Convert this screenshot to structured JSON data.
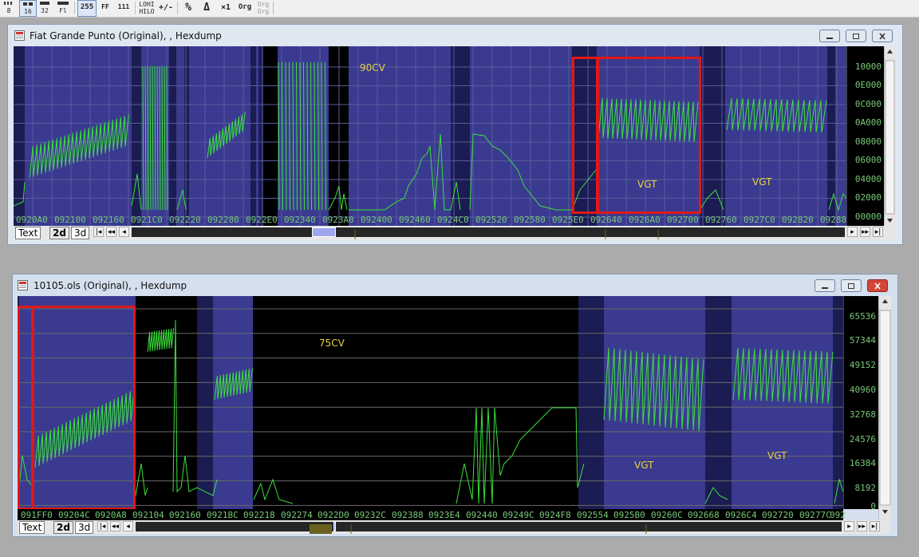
{
  "toolbar": {
    "items": [
      "8",
      "16",
      "32",
      "Fl",
      "255",
      "FF",
      "111",
      "LOHI HILO",
      "+/-",
      "%",
      "Δ",
      "×1",
      "Org",
      "Org Org"
    ]
  },
  "window1": {
    "title": "Fiat Grande Punto (Original), , Hexdump",
    "y_ticks": [
      "10000",
      "0E000",
      "0C000",
      "0A000",
      "08000",
      "06000",
      "04000",
      "02000",
      "00000"
    ],
    "x_ticks": [
      "0920A0",
      "092100",
      "092160",
      "0921C0",
      "092220",
      "092280",
      "0922E0",
      "092340",
      "0923A0",
      "092400",
      "092460",
      "0924C0",
      "092520",
      "092580",
      "0925E0",
      "092640",
      "0926A0",
      "092700",
      "092760",
      "0927C0",
      "092820",
      "09288"
    ],
    "annotations": [
      "90CV",
      "VGT",
      "VGT"
    ],
    "tabs": [
      "Text",
      "2d",
      "3d"
    ]
  },
  "window2": {
    "title": "10105.ols (Original), , Hexdump",
    "y_ticks": [
      "65536",
      "57344",
      "49152",
      "40960",
      "32768",
      "24576",
      "16384",
      "8192",
      "0"
    ],
    "x_ticks": [
      "091FF0",
      "09204C",
      "0920A8",
      "092104",
      "092160",
      "0921BC",
      "092218",
      "092274",
      "0922D0",
      "09232C",
      "092388",
      "0923E4",
      "092440",
      "09249C",
      "0924F8",
      "092554",
      "0925B0",
      "09260C",
      "092668",
      "0926C4",
      "092720",
      "09277C",
      "092"
    ],
    "annotations": [
      "75CV",
      "VGT",
      "VGT"
    ],
    "tabs": [
      "Text",
      "2d",
      "3d"
    ]
  },
  "colors": {
    "map_region": "#3a3a90",
    "map_region_dark": "#1b1c52",
    "trace": "#3ae23a",
    "annotation": "#e8d53a",
    "highlight": "#e01818"
  }
}
